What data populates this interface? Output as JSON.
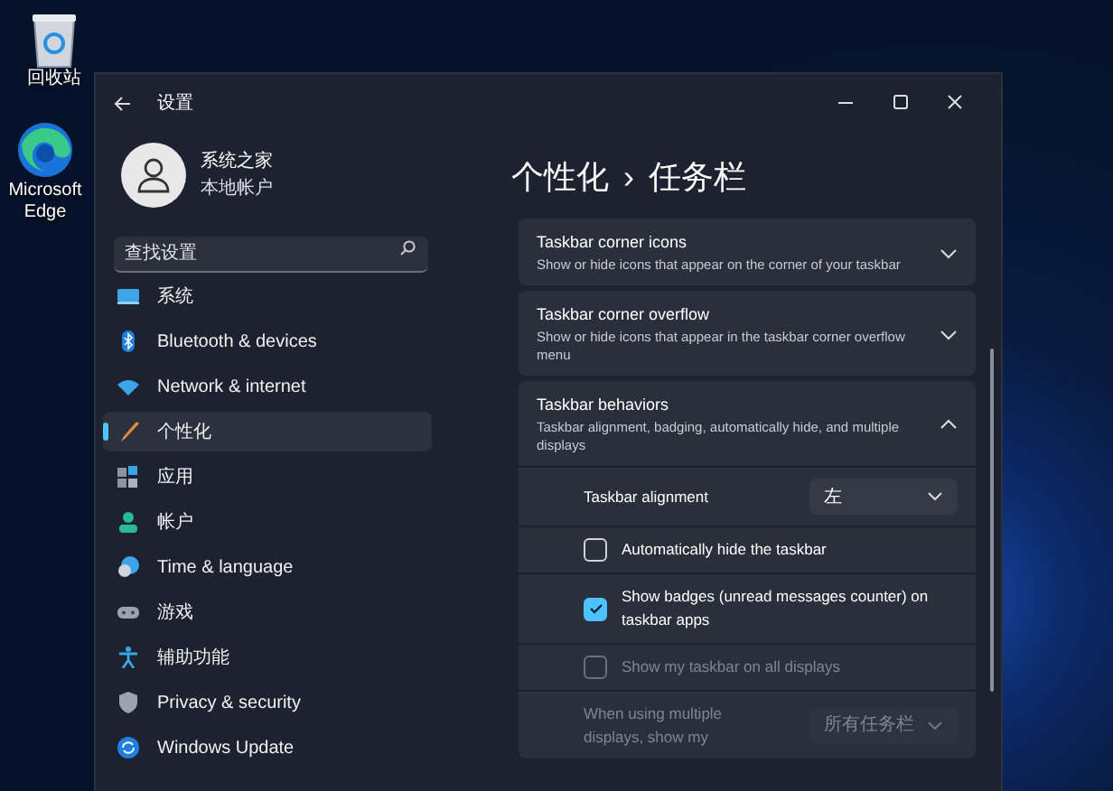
{
  "desktop_icons": [
    {
      "label": "回收站"
    },
    {
      "label": "Microsoft Edge"
    }
  ],
  "window": {
    "title": "设置"
  },
  "account": {
    "name": "系统之家",
    "type": "本地帐户"
  },
  "search": {
    "placeholder": "查找设置"
  },
  "nav": [
    {
      "label": "系统",
      "selected": false
    },
    {
      "label": "Bluetooth & devices",
      "selected": false
    },
    {
      "label": "Network & internet",
      "selected": false
    },
    {
      "label": "个性化",
      "selected": true
    },
    {
      "label": "应用",
      "selected": false
    },
    {
      "label": "帐户",
      "selected": false
    },
    {
      "label": "Time & language",
      "selected": false
    },
    {
      "label": "游戏",
      "selected": false
    },
    {
      "label": "辅助功能",
      "selected": false
    },
    {
      "label": "Privacy & security",
      "selected": false
    },
    {
      "label": "Windows Update",
      "selected": false
    }
  ],
  "breadcrumb": {
    "parent": "个性化",
    "separator": "›",
    "current": "任务栏"
  },
  "sections": [
    {
      "title": "Taskbar corner icons",
      "description": "Show or hide icons that appear on the corner of your taskbar",
      "expanded": false
    },
    {
      "title": "Taskbar corner overflow",
      "description": "Show or hide icons that appear in the taskbar corner overflow menu",
      "expanded": false
    },
    {
      "title": "Taskbar behaviors",
      "description": "Taskbar alignment, badging, automatically hide, and multiple displays",
      "expanded": true,
      "settings": [
        {
          "kind": "dropdown",
          "label": "Taskbar alignment",
          "value": "左",
          "disabled": false
        },
        {
          "kind": "checkbox",
          "label": "Automatically hide the taskbar",
          "checked": false,
          "disabled": false
        },
        {
          "kind": "checkbox",
          "label": "Show badges (unread messages counter) on taskbar apps",
          "checked": true,
          "disabled": false
        },
        {
          "kind": "checkbox",
          "label": "Show my taskbar on all displays",
          "checked": false,
          "disabled": true
        },
        {
          "kind": "dropdown",
          "label": "When using multiple displays, show my",
          "value": "所有任务栏",
          "disabled": true
        }
      ]
    }
  ]
}
